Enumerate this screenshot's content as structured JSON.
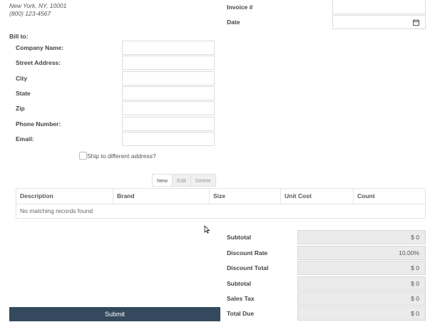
{
  "company": {
    "address_line": "New York, NY, 10001",
    "phone": "(800) 123-4567"
  },
  "invoice": {
    "number_label": "Invoice #",
    "date_label": "Date"
  },
  "bill_to": {
    "title": "Bill to:",
    "fields": [
      {
        "label": "Company Name:",
        "value": ""
      },
      {
        "label": "Street Address:",
        "value": ""
      },
      {
        "label": "City",
        "value": ""
      },
      {
        "label": "State",
        "value": ""
      },
      {
        "label": "Zip",
        "value": ""
      },
      {
        "label": "Phone Number:",
        "value": ""
      },
      {
        "label": "Email:",
        "value": ""
      }
    ],
    "ship_checkbox_label": "Ship to different address?"
  },
  "toolbar": {
    "new": "New",
    "edit": "Edit",
    "delete": "Delete"
  },
  "table": {
    "columns": [
      "Description",
      "Brand",
      "Size",
      "Unit Cost",
      "Count"
    ],
    "empty_message": "No matching records found"
  },
  "totals": [
    {
      "label": "Subtotal",
      "value": "$ 0"
    },
    {
      "label": "Discount Rate",
      "value": "10.00%"
    },
    {
      "label": "Discount Total",
      "value": "$ 0"
    },
    {
      "label": "Subtotal",
      "value": "$ 0"
    },
    {
      "label": "Sales Tax",
      "value": "$ 0"
    },
    {
      "label": "Total Due",
      "value": "$ 0"
    }
  ],
  "submit_label": "Submit",
  "colors": {
    "submit_bg": "#34495e",
    "readonly_bg": "#ebebeb"
  },
  "icons": {
    "date_picker": "calendar-icon"
  }
}
